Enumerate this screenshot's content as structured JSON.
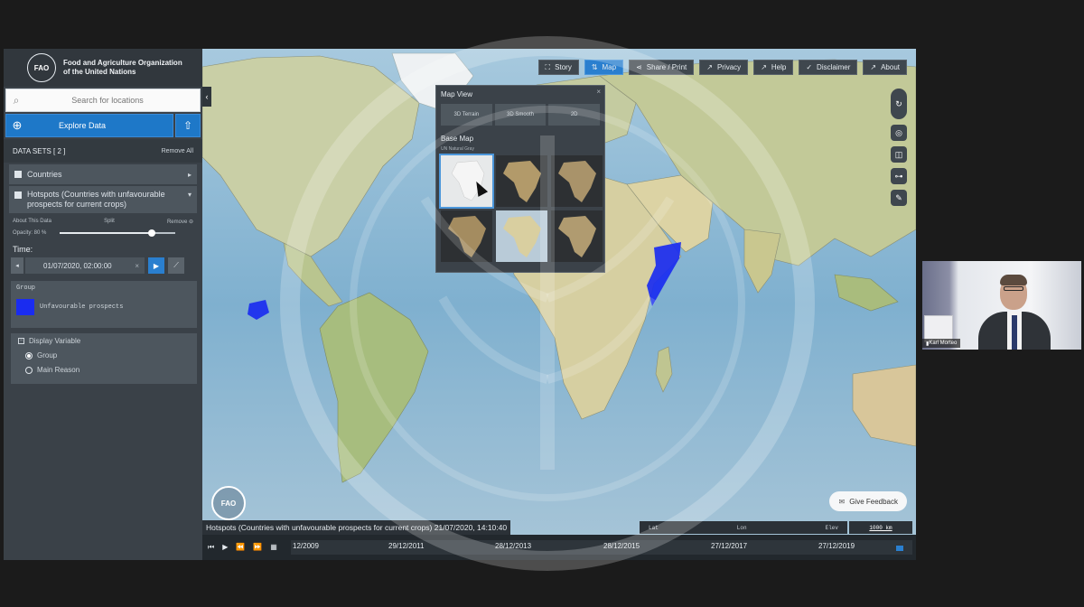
{
  "org": {
    "logo_text": "FAO",
    "name": "Food and Agriculture Organization of the United Nations"
  },
  "search": {
    "placeholder": "Search for locations"
  },
  "explore": {
    "label": "Explore Data"
  },
  "datasets": {
    "header": "DATA SETS  [ 2 ]",
    "remove_all": "Remove All",
    "items": [
      {
        "label": "Countries"
      },
      {
        "label": "Hotspots (Countries with unfavourable prospects for current crops)"
      }
    ],
    "controls": {
      "about": "About This Data",
      "split": "Split",
      "remove": "Remove",
      "opacity_label": "Opacity: 80 %",
      "opacity_value": 0.8
    }
  },
  "time": {
    "label": "Time:",
    "value": "01/07/2020, 02:00:00",
    "clear": "×"
  },
  "legend": {
    "title": "Group",
    "item": "Unfavourable prospects",
    "color": "#1a2cf0"
  },
  "display_variable": {
    "title": "Display Variable",
    "options": [
      "Group",
      "Main Reason"
    ],
    "selected": "Group"
  },
  "nav": {
    "story": "Story",
    "map": "Map",
    "share": "Share / Print",
    "privacy": "Privacy",
    "help": "Help",
    "disclaimer": "Disclaimer",
    "about": "About"
  },
  "map_view": {
    "title": "Map View",
    "modes": [
      "3D Terrain",
      "3D Smooth",
      "2D"
    ],
    "base_map_title": "Base Map",
    "base_map_selected": "UN Natural Gray"
  },
  "feedback": {
    "label": "Give Feedback"
  },
  "status": {
    "text": "Hotspots (Countries with unfavourable prospects for current crops) 21/07/2020, 14:10:40",
    "lat": "Lat",
    "lon": "Lon",
    "elev": "Elev",
    "scale": "1000 km"
  },
  "timeline": {
    "labels": [
      "12/2009",
      "29/12/2011",
      "28/12/2013",
      "28/12/2015",
      "27/12/2017",
      "27/12/2019"
    ]
  },
  "video": {
    "name": "Karl Morteo"
  },
  "colors": {
    "accent": "#2a7fcf",
    "hotspot": "#1a2cf0",
    "panel": "#3a4148"
  }
}
